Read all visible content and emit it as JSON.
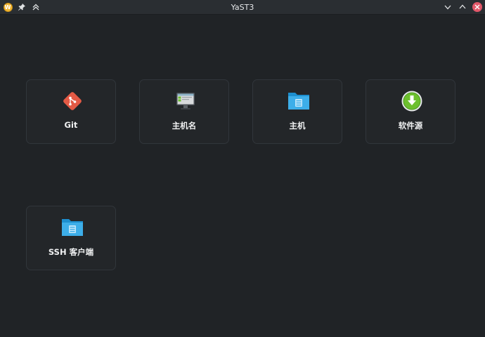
{
  "window": {
    "title": "YaST3",
    "app_icon_letter": "W"
  },
  "titlebar_buttons": {
    "left": [
      "app-icon",
      "pin-icon",
      "keep-above-icon"
    ],
    "right": [
      "minimize-icon",
      "maximize-icon",
      "close-icon"
    ]
  },
  "tiles": [
    {
      "label": "Git",
      "icon": "git-icon",
      "color": "#e45a45"
    },
    {
      "label": "主机名",
      "icon": "monitor-icon",
      "color": "#4a4f55"
    },
    {
      "label": "主机",
      "icon": "folder-icon",
      "color": "#3daee9"
    },
    {
      "label": "软件源",
      "icon": "download-icon",
      "color": "#6cbf2e"
    },
    {
      "label": "SSH 客户端",
      "icon": "folder-icon",
      "color": "#3daee9"
    }
  ]
}
